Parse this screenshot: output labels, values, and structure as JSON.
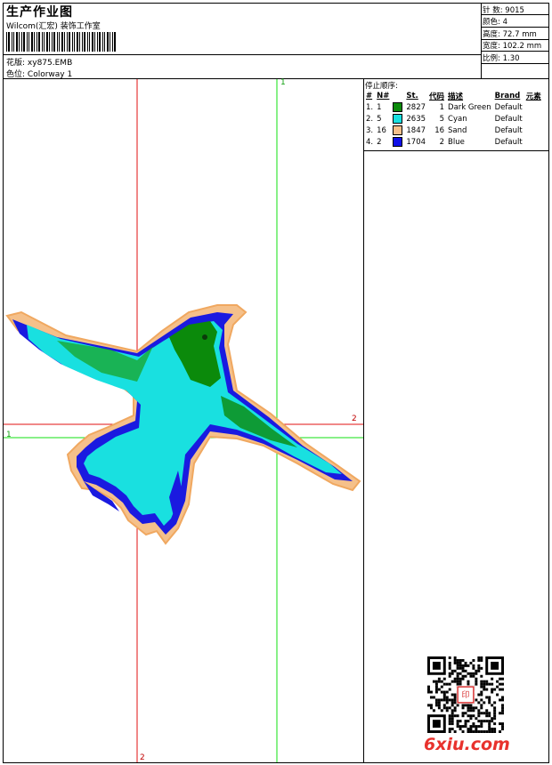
{
  "header": {
    "title": "生产作业图",
    "subtitle": "Wilcom(汇宏) 装饰工作室",
    "design_label": "花版:",
    "design_value": "xy875.EMB",
    "colorway_label": "色位:",
    "colorway_value": "Colorway 1"
  },
  "stats": [
    {
      "label": "针 数:",
      "value": "9015"
    },
    {
      "label": "颜色:",
      "value": "4"
    },
    {
      "label": "高度:",
      "value": "72.7 mm"
    },
    {
      "label": "宽度:",
      "value": "102.2 mm"
    },
    {
      "label": "比例:",
      "value": "1.30"
    }
  ],
  "stop_sequence": {
    "title": "停止顺序:",
    "columns": [
      "#",
      "N#",
      "St.",
      "代码",
      "描述",
      "Brand",
      "元素"
    ],
    "rows": [
      {
        "index": "1.",
        "needle": "1",
        "color": "#0b8a0b",
        "stitches": "2827",
        "code": "1",
        "desc": "Dark Green",
        "brand": "Default"
      },
      {
        "index": "2.",
        "needle": "5",
        "color": "#19e0e0",
        "stitches": "2635",
        "code": "5",
        "desc": "Cyan",
        "brand": "Default"
      },
      {
        "index": "3.",
        "needle": "16",
        "color": "#f5c08a",
        "stitches": "1847",
        "code": "16",
        "desc": "Sand",
        "brand": "Default"
      },
      {
        "index": "4.",
        "needle": "2",
        "color": "#1010e8",
        "stitches": "1704",
        "code": "2",
        "desc": "Blue",
        "brand": "Default"
      }
    ]
  },
  "axes": {
    "green_label": "1",
    "red_label": "2"
  },
  "watermark": "6xiu.com"
}
